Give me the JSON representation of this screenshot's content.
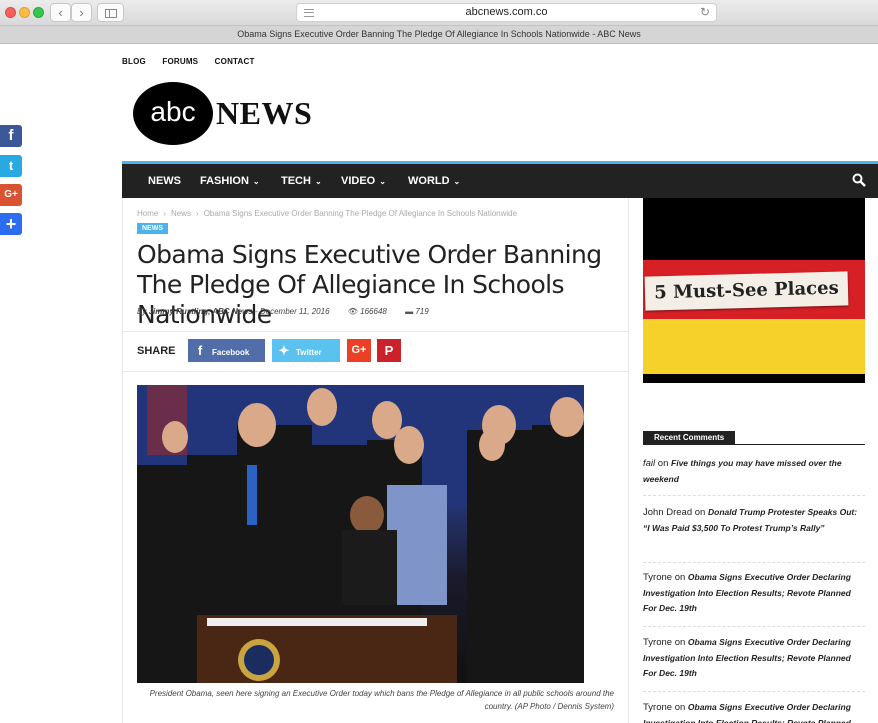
{
  "browser": {
    "url": "abcnews.com.co",
    "tab_title": "Obama Signs Executive Order Banning The Pledge Of Allegiance In Schools Nationwide - ABC News",
    "back": "‹",
    "forward": "›",
    "reload": "↻"
  },
  "toplinks": [
    "BLOG",
    "FORUMS",
    "CONTACT"
  ],
  "logo": {
    "circle_text": "abc",
    "word": "NEWS"
  },
  "social_side": [
    "f",
    "t",
    "G+",
    "+"
  ],
  "nav": {
    "items": [
      {
        "label": "NEWS",
        "has_menu": false
      },
      {
        "label": "FASHION",
        "has_menu": true
      },
      {
        "label": "TECH",
        "has_menu": true
      },
      {
        "label": "VIDEO",
        "has_menu": true
      },
      {
        "label": "WORLD",
        "has_menu": true
      }
    ],
    "chevron": "⌄"
  },
  "breadcrumb": {
    "home": "Home",
    "section": "News",
    "current": "Obama Signs Executive Order Banning The Pledge Of Allegiance In Schools Nationwide",
    "separator": "›"
  },
  "article": {
    "category": "NEWS",
    "title": "Obama Signs Executive Order Banning The Pledge Of Allegiance In Schools Nationwide",
    "by": "By",
    "author": "Jimmy Rustling, ABC News",
    "date_sep": " - ",
    "date": "December 11, 2016",
    "views": "166648",
    "comments": "719",
    "caption": "President Obama, seen here signing an Executive Order today which bans the Pledge of Allegiance in all public schools around the country. (AP Photo / Dennis System)"
  },
  "share": {
    "label": "SHARE",
    "facebook": "Facebook",
    "twitter": "Twitter",
    "gplus": "G+",
    "pinterest": "P"
  },
  "ad": {
    "text": "5 Must-See Places"
  },
  "recent_comments": {
    "title": "Recent Comments",
    "on": "on",
    "items": [
      {
        "author": "fail",
        "post": "Five things you may have missed over the weekend"
      },
      {
        "author": "John Dread",
        "post": "Donald Trump Protester Speaks Out: “I Was Paid $3,500 To Protest Trump’s Rally”"
      },
      {
        "author": "Tyrone",
        "post": "Obama Signs Executive Order Declaring Investigation Into Election Results; Revote Planned For Dec. 19th"
      },
      {
        "author": "Tyrone",
        "post": "Obama Signs Executive Order Declaring Investigation Into Election Results; Revote Planned For Dec. 19th"
      },
      {
        "author": "Tyrone",
        "post": "Obama Signs Executive Order Declaring Investigation Into Election Results; Revote Planned For Dec. 19th"
      }
    ]
  },
  "colors": {
    "accent": "#4db2ec",
    "nav_bg": "#222222",
    "facebook": "#516eab",
    "twitter": "#29c5f6",
    "gplus": "#eb4026",
    "pinterest": "#ca212a"
  }
}
